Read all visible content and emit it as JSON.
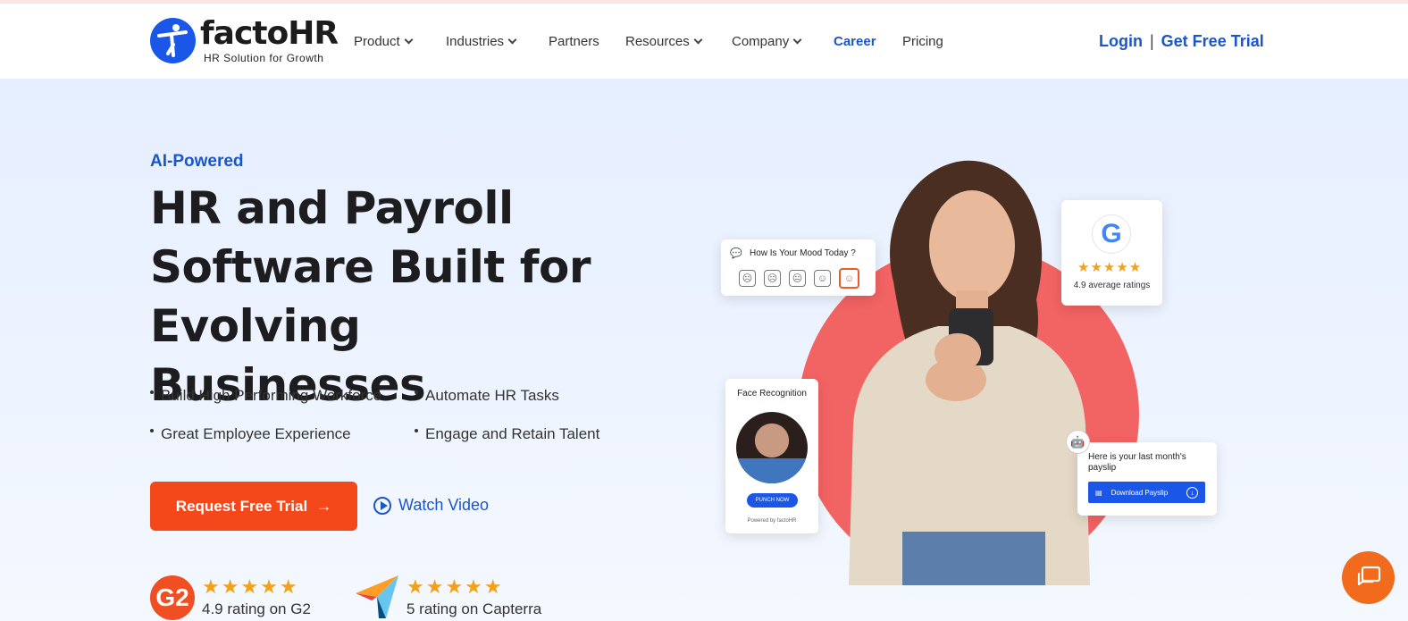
{
  "brand": {
    "name": "factoHR",
    "tagline": "HR Solution for Growth",
    "accent": "#1a56c8",
    "cta_color": "#f5481a"
  },
  "nav": {
    "items": [
      {
        "label": "Product",
        "dropdown": true
      },
      {
        "label": "Industries",
        "dropdown": true
      },
      {
        "label": "Partners",
        "dropdown": false
      },
      {
        "label": "Resources",
        "dropdown": true
      },
      {
        "label": "Company",
        "dropdown": true
      },
      {
        "label": "Career",
        "dropdown": false,
        "active": true
      },
      {
        "label": "Pricing",
        "dropdown": false
      }
    ],
    "login": "Login",
    "separator": "|",
    "trial": "Get Free Trial"
  },
  "hero": {
    "eyebrow": "AI-Powered",
    "headline_1": "HR and Payroll",
    "headline_2": "Software Built for",
    "headline_3": "Evolving Businesses",
    "bullets": [
      "Build High Performing Workforce",
      "Automate HR Tasks",
      "Great Employee Experience",
      "Engage and Retain Talent"
    ],
    "cta_label": "Request Free Trial",
    "cta_arrow": "→",
    "watch_label": "Watch Video"
  },
  "ratings": [
    {
      "logo": "G2",
      "stars": "★★★★★",
      "text": "4.9 rating on G2"
    },
    {
      "logo": "capterra-logo",
      "stars": "★★★★★",
      "text": "5 rating on Capterra"
    }
  ],
  "cards": {
    "mood": {
      "title": "How Is Your Mood Today ?",
      "faces": [
        "☹",
        "☹",
        "😐",
        "☺",
        "☺"
      ]
    },
    "google": {
      "logo": "G",
      "stars": "★★★★★",
      "text": "4.9 average ratings"
    },
    "face": {
      "title": "Face Recognition",
      "button": "PUNCH NOW",
      "footer": "Powered by factoHR"
    },
    "payslip": {
      "text": "Here is your last month's payslip",
      "button": "Download Payslip"
    }
  }
}
